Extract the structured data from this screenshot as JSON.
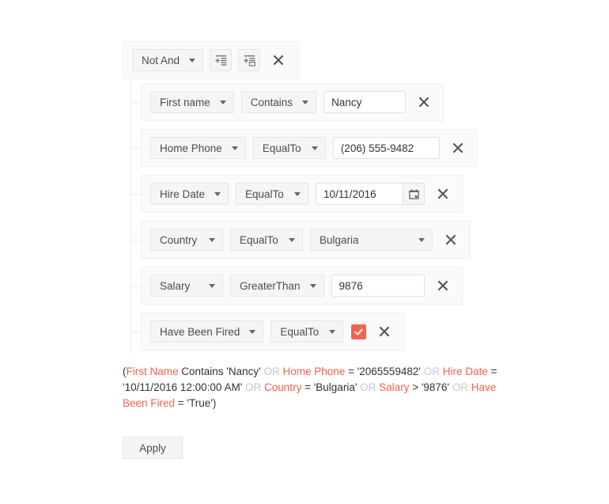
{
  "colors": {
    "accent": "#f9604f",
    "control_bg": "#f5f5f5",
    "row_bg": "#fafafa",
    "text": "#333333",
    "muted": "#c9c9c9"
  },
  "group": {
    "logic_operator": "Not And",
    "add_condition_title": "Add Condition",
    "add_group_title": "Add Group",
    "remove_title": "Remove Group"
  },
  "conditions": [
    {
      "field": "First name",
      "operator": "Contains",
      "value_kind": "text",
      "value": "Nancy",
      "value_width": "104px"
    },
    {
      "field": "Home Phone",
      "operator": "EqualTo",
      "value_kind": "text",
      "value": "(206) 555-9482",
      "value_width": "135px"
    },
    {
      "field": "Hire Date",
      "operator": "EqualTo",
      "value_kind": "date",
      "value": "10/11/2016",
      "value_width": "110px"
    },
    {
      "field": "Country",
      "operator": "EqualTo",
      "value_kind": "dropdown",
      "value": "Bulgaria",
      "value_width": "155px"
    },
    {
      "field": "Salary",
      "operator": "GreaterThan",
      "value_kind": "text",
      "value": "9876",
      "value_width": "118px"
    },
    {
      "field": "Have Been Fired",
      "operator": "EqualTo",
      "value_kind": "checkbox",
      "value": "True",
      "value_width": "0px"
    }
  ],
  "expression": {
    "parts": [
      {
        "text": "(",
        "style": "plain"
      },
      {
        "text": "First Name",
        "style": "field"
      },
      {
        "text": " Contains 'Nancy' ",
        "style": "plain"
      },
      {
        "text": "OR",
        "style": "op"
      },
      {
        "text": " ",
        "style": "plain"
      },
      {
        "text": "Home Phone",
        "style": "field"
      },
      {
        "text": " = '2065559482' ",
        "style": "plain"
      },
      {
        "text": "OR",
        "style": "op"
      },
      {
        "text": " ",
        "style": "plain"
      },
      {
        "text": "Hire Date",
        "style": "field"
      },
      {
        "text": " = '10/11/2016 12:00:00 AM' ",
        "style": "plain"
      },
      {
        "text": "OR",
        "style": "op"
      },
      {
        "text": " ",
        "style": "plain"
      },
      {
        "text": "Country",
        "style": "field"
      },
      {
        "text": " = 'Bulgaria' ",
        "style": "plain"
      },
      {
        "text": "OR",
        "style": "op"
      },
      {
        "text": " ",
        "style": "plain"
      },
      {
        "text": "Salary",
        "style": "field"
      },
      {
        "text": " > '9876' ",
        "style": "plain"
      },
      {
        "text": "OR",
        "style": "op"
      },
      {
        "text": " ",
        "style": "plain"
      },
      {
        "text": "Have Been Fired",
        "style": "field"
      },
      {
        "text": " = 'True')",
        "style": "plain"
      }
    ]
  },
  "apply": {
    "label": "Apply"
  }
}
